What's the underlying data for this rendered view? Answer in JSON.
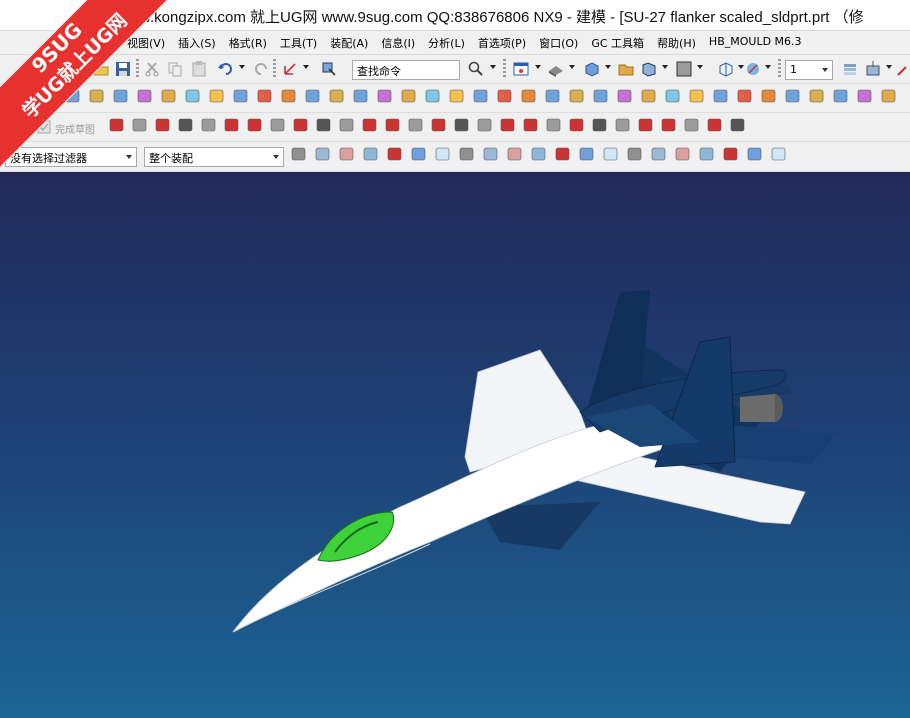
{
  "window": {
    "title": "w.kongzipx.com 就上UG网 www.9sug.com QQ:838676806 NX9 - 建模 - [SU-27 flanker scaled_sldprt.prt （修"
  },
  "watermark": {
    "top": "9SUG",
    "bottom": "学UG就上UG网",
    "color": "#e7312f"
  },
  "menu": {
    "items": [
      "视图(V)",
      "插入(S)",
      "格式(R)",
      "工具(T)",
      "装配(A)",
      "信息(I)",
      "分析(L)",
      "首选项(P)",
      "窗口(O)",
      "GC 工具箱",
      "帮助(H)",
      "HB_MOULD M6.3"
    ]
  },
  "toolbar1": {
    "command_search_value": "查找命令",
    "layer_value": "1"
  },
  "toolbar3": {
    "finish_sketch_label": "完成草图"
  },
  "toolbar4": {
    "selection_filter_value": "没有选择过滤器",
    "assembly_scope_value": "整个装配"
  },
  "viewport": {
    "background_top": "#232a5a",
    "background_bottom": "#1c6595",
    "model_name": "SU-27 flanker",
    "canopy_color": "#3dd13a",
    "fuselage_color": "#ffffff",
    "tail_color": "#163a66"
  },
  "icons": {
    "toolbar1": [
      "cut-icon",
      "copy-icon",
      "paste-icon",
      "undo-icon",
      "redo-icon",
      "csys-icon",
      "select-icon",
      "search-icon",
      "layout-icon",
      "shaded-view-icon",
      "block-icon",
      "wcs-icon",
      "view-orient-icon",
      "color-square-icon",
      "fit-icon",
      "render-icon",
      "layer-settings-icon",
      "layer-move-icon",
      "tool-icon"
    ],
    "toolbar4": [
      "snap-icon",
      "rotate-icon",
      "select-box-icon",
      "select-face-icon",
      "point-icon",
      "line-icon",
      "curve-icon",
      "arc-icon",
      "circle-center-icon",
      "intersect-icon",
      "plus-icon",
      "tangent-icon",
      "grid-icon"
    ]
  }
}
